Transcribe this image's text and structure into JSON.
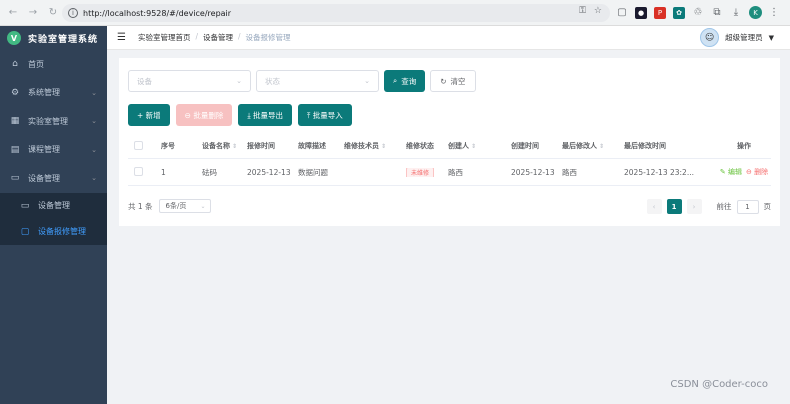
{
  "browser": {
    "url": "http://localhost:9528/#/device/repair",
    "back": "←",
    "forward": "→",
    "reload": "↻",
    "info": "i",
    "icons": [
      "⚿",
      "☆"
    ],
    "extensions": [
      {
        "name": "ext-square-icon",
        "glyph": "▢",
        "color": ""
      },
      {
        "name": "ext-circle-icon",
        "glyph": "●",
        "color": "#1a1a2e"
      },
      {
        "name": "ext-pdf-icon",
        "glyph": "P",
        "color": "#d93025"
      },
      {
        "name": "ext-gear-icon",
        "glyph": "✿",
        "color": "#0b7a7a"
      },
      {
        "name": "ext-recycle-icon",
        "glyph": "♲",
        "color": ""
      },
      {
        "name": "extensions-icon",
        "glyph": "⧉",
        "color": ""
      },
      {
        "name": "download-icon",
        "glyph": "⤓",
        "color": ""
      }
    ],
    "profile_initial": "K",
    "menu": "⋮"
  },
  "sidebar": {
    "logo_letter": "V",
    "title": "实验室管理系统",
    "items": [
      {
        "label": "首页",
        "icon": "⌂",
        "icon_name": "home-icon",
        "has_chevron": false
      },
      {
        "label": "系统管理",
        "icon": "⚙",
        "icon_name": "gear-icon",
        "has_chevron": true
      },
      {
        "label": "实验室管理",
        "icon": "▦",
        "icon_name": "building-icon",
        "has_chevron": true
      },
      {
        "label": "课程管理",
        "icon": "▤",
        "icon_name": "book-icon",
        "has_chevron": true
      },
      {
        "label": "设备管理",
        "icon": "▭",
        "icon_name": "monitor-icon",
        "has_chevron": true
      }
    ],
    "subitems": [
      {
        "label": "设备管理",
        "icon": "▭",
        "icon_name": "monitor-icon",
        "active": false
      },
      {
        "label": "设备报修管理",
        "icon": "▢",
        "icon_name": "document-icon",
        "active": true
      }
    ],
    "chevron": "⌄"
  },
  "header": {
    "hamburger": "☰",
    "breadcrumb": [
      "实验室管理首页",
      "设备管理",
      "设备报修管理"
    ],
    "separator": "/",
    "user_name": "超级管理员",
    "caret": "▼",
    "avatar_glyph": "☺"
  },
  "filters": {
    "device_placeholder": "设备",
    "status_placeholder": "状态",
    "arrow": "⌄",
    "query_label": "查询",
    "query_icon": "⌕",
    "clear_label": "清空",
    "clear_icon": "↻"
  },
  "actions": {
    "add": "+ 新增",
    "batch_delete": "⊖ 批量删除",
    "export": "⤓ 批量导出",
    "import": "⤒ 批量导入"
  },
  "table": {
    "columns": [
      "序号",
      "设备名称",
      "报修时间",
      "故障描述",
      "维修技术员",
      "维修状态",
      "创建人",
      "创建时间",
      "最后修改人",
      "最后修改时间",
      "操作"
    ],
    "sort_glyph": "⇕",
    "rows": [
      {
        "index": "1",
        "device": "砝码",
        "repair_time": "2025-12-13",
        "fault": "数据问题",
        "technician": "",
        "status": "未维修",
        "creator": "路西",
        "created": "2025-12-13 2...",
        "modifier": "路西",
        "modified": "2025-12-13 23:2...",
        "edit": "✎ 编辑",
        "delete": "⊖ 删除"
      }
    ]
  },
  "pagination": {
    "total": "共 1 条",
    "page_size": "6条/页",
    "arrow": "⌄",
    "prev": "‹",
    "current": "1",
    "next": "›",
    "goto_label": "前往",
    "goto_value": "1",
    "page_unit": "页"
  },
  "watermark": "CSDN @Coder-coco"
}
